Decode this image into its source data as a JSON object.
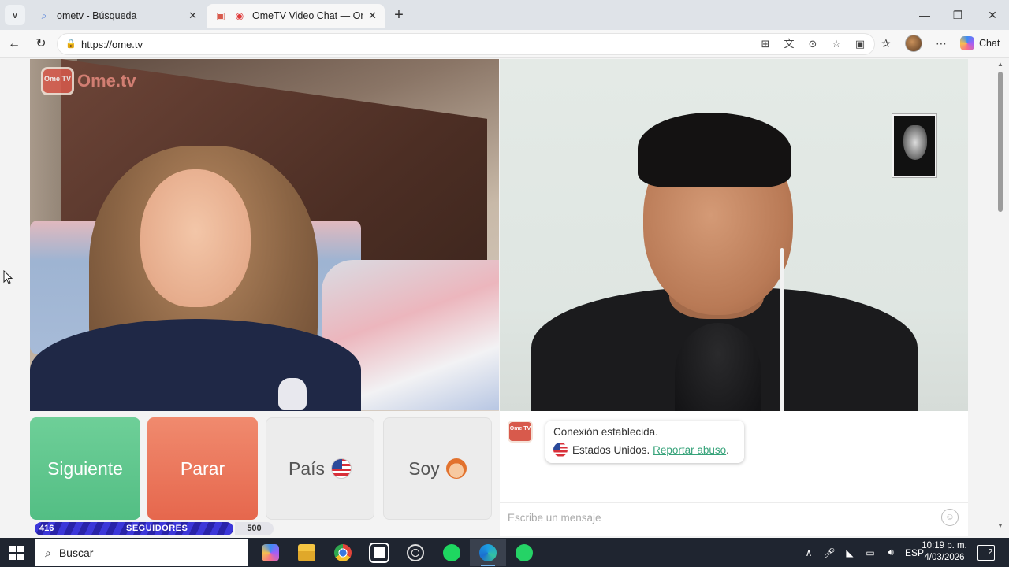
{
  "browser": {
    "tabs": [
      {
        "title": "ometv - Búsqueda",
        "icon": "search-icon"
      },
      {
        "title": "OmeTV Video Chat — Omegl",
        "icon": "record-icon"
      }
    ],
    "url": "https://ome.tv",
    "chat_label": "Chat"
  },
  "video": {
    "logo_badge": "Ome TV",
    "logo_text": "Ome.tv"
  },
  "controls": {
    "next_label": "Siguiente",
    "stop_label": "Parar",
    "country_label": "País",
    "gender_label": "Soy"
  },
  "chat": {
    "logo_badge": "Ome TV",
    "status": "Conexión establecida.",
    "country": "Estados Unidos.",
    "report_link": "Reportar abuso",
    "report_suffix": ".",
    "input_placeholder": "Escribe un mensaje"
  },
  "followers": {
    "current": "416",
    "label": "SEGUIDORES",
    "goal": "500"
  },
  "taskbar": {
    "search_label": "Buscar",
    "apps": [
      "copilot",
      "file-explorer",
      "chrome",
      "capcut",
      "obs",
      "spotify",
      "edge",
      "whatsapp"
    ],
    "language": "ESP",
    "time": "10:19 p. m.",
    "date": "4/03/2026",
    "notifications": "2"
  },
  "colors": {
    "next": "#5ec78e",
    "stop": "#ea6f53",
    "link": "#37a37a",
    "followers_bar": "#3330c8"
  }
}
